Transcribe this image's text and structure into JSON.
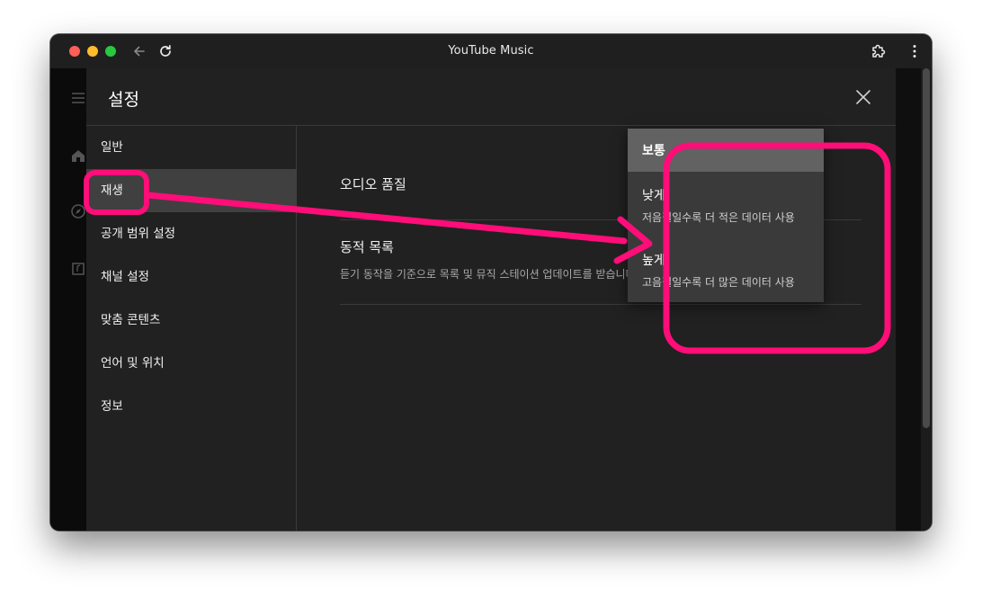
{
  "window": {
    "title": "YouTube Music"
  },
  "dialog": {
    "title": "설정",
    "sidebar": [
      {
        "label": "일반"
      },
      {
        "label": "재생",
        "active": true
      },
      {
        "label": "공개 범위 설정"
      },
      {
        "label": "채널 설정"
      },
      {
        "label": "맞춤 콘텐츠"
      },
      {
        "label": "언어 및 위치"
      },
      {
        "label": "정보"
      }
    ],
    "audio_quality": {
      "label": "오디오 품질"
    },
    "dynamic_list": {
      "label": "동적 목록",
      "description": "듣기 동작을 기준으로 목록 및 뮤직 스테이션 업데이트를 받습니다."
    }
  },
  "dropdown": {
    "options": [
      {
        "label": "보통",
        "selected": true
      },
      {
        "label": "낮게",
        "description": "저음질일수록 더 적은 데이터 사용"
      },
      {
        "label": "높게",
        "description": "고음질일수록 더 많은 데이터 사용"
      }
    ]
  },
  "annotation_color": "#ff0d78",
  "icons": [
    "back-arrow-icon",
    "reload-icon",
    "extension-icon",
    "more-vert-icon",
    "close-icon",
    "menu-icon",
    "home-icon",
    "explore-icon",
    "library-icon"
  ]
}
